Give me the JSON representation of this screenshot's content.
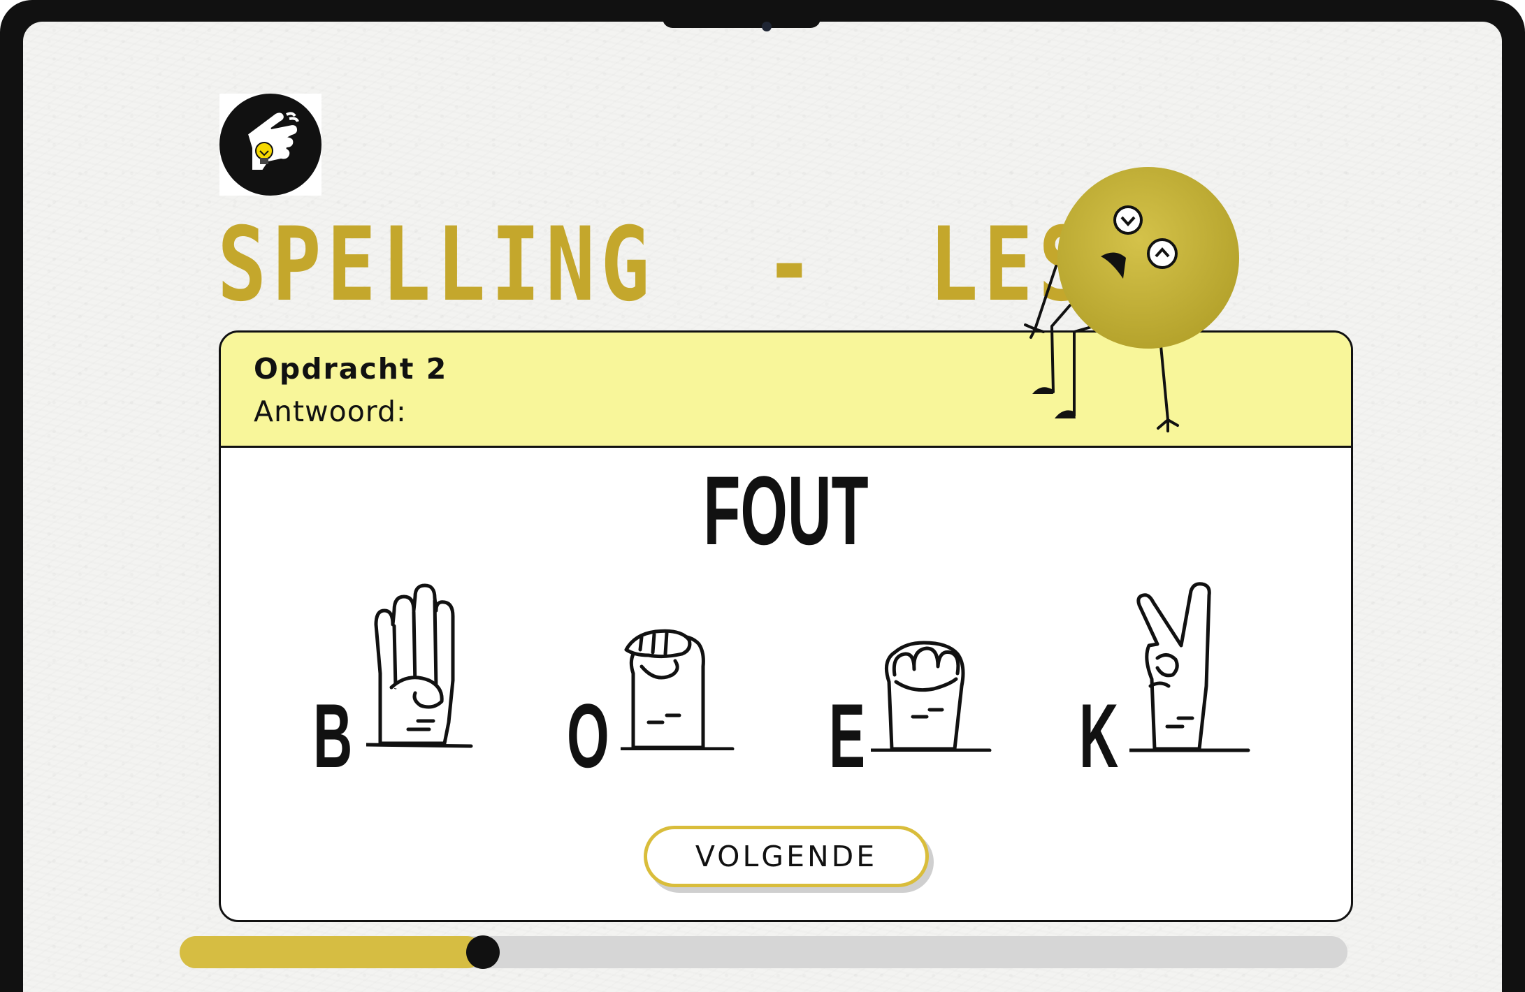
{
  "lesson": {
    "title": "SPELLING  -  LES 1"
  },
  "exercise": {
    "task_label": "Opdracht 2",
    "answer_label": "Antwoord:",
    "result_text": "FOUT",
    "letters": [
      "B",
      "O",
      "E",
      "K"
    ],
    "next_button_label": "VOLGENDE"
  },
  "progress": {
    "value_fraction": 0.26
  },
  "colors": {
    "accent_gold": "#c4a72c",
    "header_yellow": "#f8f69a",
    "button_border": "#d9bd3b",
    "progress_fill": "#d6bd42",
    "mascot_body": "#c9b83a"
  },
  "icons": {
    "logo": "hand-lightbulb-icon",
    "mascot": "sad-mascot-character"
  }
}
